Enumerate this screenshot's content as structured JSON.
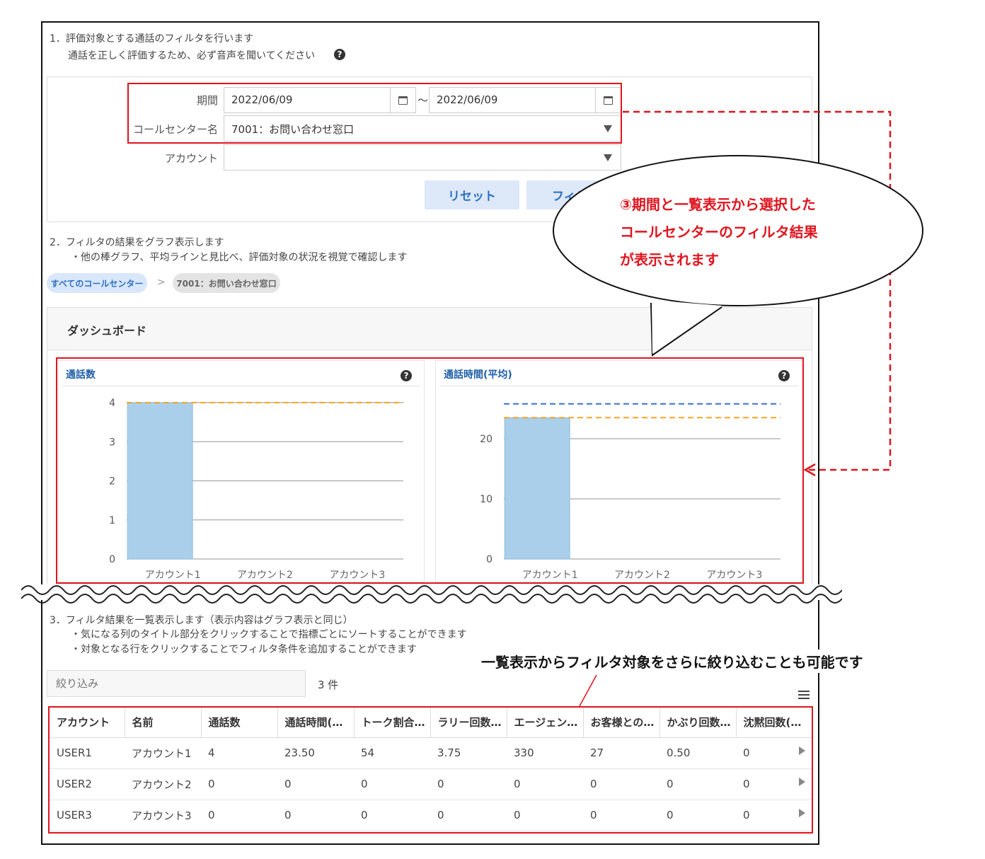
{
  "section1": {
    "title": "1．評価対象とする通話のフィルタを行います",
    "note": "通話を正しく評価するため、必ず音声を聞いてください"
  },
  "filter": {
    "period_label": "期間",
    "date_from": "2022/06/09",
    "range_sep": "～",
    "date_to": "2022/06/09",
    "callcenter_label": "コールセンター名",
    "callcenter_value": "7001：お問い合わせ窓口",
    "account_label": "アカウント",
    "account_value": "",
    "reset_label": "リセット",
    "filter_label": "フィル"
  },
  "section2": {
    "title": "2．フィルタの結果をグラフ表示します",
    "note": "・他の棒グラフ、平均ラインと見比べ、評価対象の状況を視覚で確認します"
  },
  "breadcrumb": {
    "all": "すべてのコールセンター",
    "sep": ">",
    "current": "7001：お問い合わせ窓口"
  },
  "dashboard": {
    "title": "ダッシュボード"
  },
  "callout": {
    "line1": "③期間と一覧表示から選択した",
    "line2": "コールセンターのフィルタ結果",
    "line3": "が表示されます"
  },
  "chart_data": [
    {
      "type": "bar",
      "title": "通話数",
      "categories": [
        "アカウント1",
        "アカウント2",
        "アカウント3"
      ],
      "values": [
        4,
        0,
        0
      ],
      "yticks": [
        0,
        1,
        2,
        3,
        4
      ],
      "ylim": [
        0,
        4
      ],
      "reference_lines": [
        {
          "color": "#f5a623",
          "value": 4
        }
      ],
      "bar_color": "#aacfea"
    },
    {
      "type": "bar",
      "title": "通話時間(平均)",
      "categories": [
        "アカウント1",
        "アカウント2",
        "アカウント3"
      ],
      "values": [
        23.5,
        0,
        0
      ],
      "yticks": [
        0,
        10,
        20
      ],
      "ylim": [
        0,
        26
      ],
      "reference_lines": [
        {
          "color": "#3a6fd8",
          "value": 25.8
        },
        {
          "color": "#f5a623",
          "value": 23.5
        }
      ],
      "bar_color": "#aacfea"
    }
  ],
  "section3": {
    "title": "3．フィルタ結果を一覧表示します（表示内容はグラフ表示と同じ）",
    "note1": "・気になる列のタイトル部分をクリックすることで指標ごとにソートすることができます",
    "note2": "・対象となる行をクリックすることでフィルタ条件を追加することができます"
  },
  "search": {
    "placeholder": "絞り込み",
    "count": "3 件"
  },
  "table_annotation": "一覧表示からフィルタ対象をさらに絞り込むことも可能です",
  "table": {
    "headers": [
      "アカウント",
      "名前",
      "通話数",
      "通話時間(…",
      "トーク割合…",
      "ラリー回数…",
      "エージェン…",
      "お客様との…",
      "かぶり回数…",
      "沈黙回数(…"
    ],
    "rows": [
      [
        "USER1",
        "アカウント1",
        "4",
        "23.50",
        "54",
        "3.75",
        "330",
        "27",
        "0.50",
        "0"
      ],
      [
        "USER2",
        "アカウント2",
        "0",
        "0",
        "0",
        "0",
        "0",
        "0",
        "0",
        "0"
      ],
      [
        "USER3",
        "アカウント3",
        "0",
        "0",
        "0",
        "0",
        "0",
        "0",
        "0",
        "0"
      ]
    ]
  },
  "colors": {
    "accent_red": "#e0141e",
    "link_blue": "#1f5fa8",
    "button_bg": "#dde8f8"
  }
}
